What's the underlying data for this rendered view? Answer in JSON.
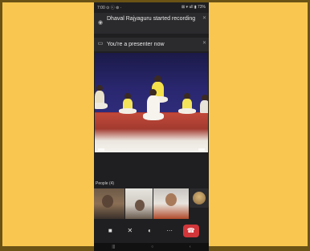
{
  "status_bar": {
    "time": "7:00 ⊙ ⓒ ⊚ ·",
    "right": "⊠ ▾ ull ▮ 73%"
  },
  "notifications": [
    {
      "text": "Dhaval Rajyaguru started recording",
      "icon": "recording-icon"
    },
    {
      "text": "You're a presenter now",
      "icon": "presenter-icon"
    }
  ],
  "people_label": "People (4)",
  "controls": [
    {
      "name": "camera",
      "glyph": "■"
    },
    {
      "name": "mute",
      "glyph": "✕"
    },
    {
      "name": "audio",
      "glyph": "◐"
    },
    {
      "name": "more",
      "glyph": "···"
    },
    {
      "name": "end",
      "glyph": "☎"
    }
  ],
  "colors": {
    "background": "#f9c74f",
    "frame": "#6b5316",
    "end_call": "#d0363a",
    "app_bg": "#1f1f21"
  }
}
